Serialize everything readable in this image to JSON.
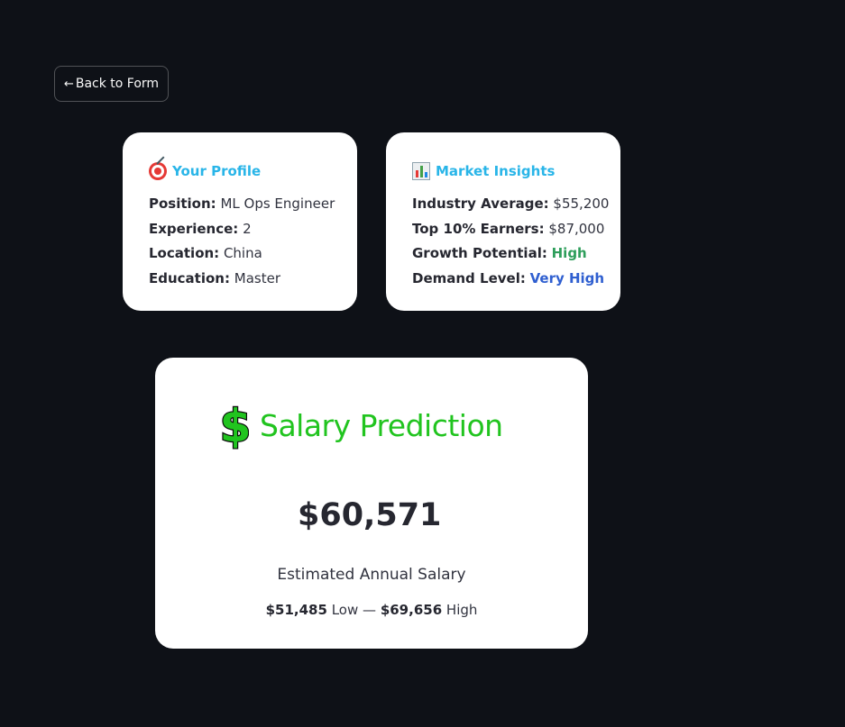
{
  "nav": {
    "back_arrow": "←",
    "back_label": "Back to Form"
  },
  "profile": {
    "title": "Your Profile",
    "icon": "target-icon",
    "items": [
      {
        "label": "Position:",
        "value": "ML Ops Engineer"
      },
      {
        "label": "Experience:",
        "value": "2"
      },
      {
        "label": "Location:",
        "value": "China"
      },
      {
        "label": "Education:",
        "value": "Master"
      }
    ]
  },
  "insights": {
    "title": "Market Insights",
    "icon": "bar-chart-icon",
    "items": [
      {
        "label": "Industry Average:",
        "value": "$55,200"
      },
      {
        "label": "Top 10% Earners:",
        "value": "$87,000"
      },
      {
        "label": "Growth Potential:",
        "value": "High"
      },
      {
        "label": "Demand Level:",
        "value": "Very High"
      }
    ]
  },
  "prediction": {
    "title": "Salary Prediction",
    "icon": "dollar-sign-icon",
    "value": "$60,571",
    "subtitle": "Estimated Annual Salary",
    "low_value": "$51,485",
    "low_label": "Low",
    "separator": "—",
    "high_value": "$69,656",
    "high_label": "High"
  },
  "colors": {
    "background": "#0e1117",
    "card_title": "#29b5e8",
    "prediction_title": "#21c41f",
    "growth_high": "#2e9e5b",
    "demand_very_high": "#2f5fd0"
  }
}
